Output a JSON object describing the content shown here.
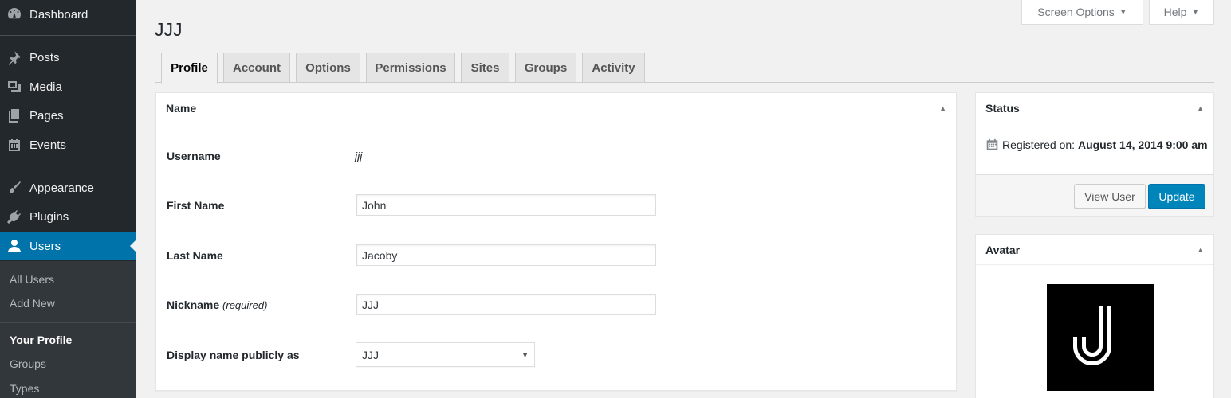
{
  "sidebar": {
    "items": [
      {
        "label": "Dashboard",
        "icon": "dashboard-icon"
      },
      {
        "label": "Posts",
        "icon": "pushpin-icon"
      },
      {
        "label": "Media",
        "icon": "media-icon"
      },
      {
        "label": "Pages",
        "icon": "pages-icon"
      },
      {
        "label": "Events",
        "icon": "calendar-icon"
      },
      {
        "label": "Appearance",
        "icon": "paintbrush-icon"
      },
      {
        "label": "Plugins",
        "icon": "plug-icon"
      },
      {
        "label": "Users",
        "icon": "user-icon"
      }
    ],
    "submenu": [
      "All Users",
      "Add New",
      "Your Profile",
      "Groups",
      "Types"
    ]
  },
  "screen_options": {
    "label": "Screen Options"
  },
  "help": {
    "label": "Help"
  },
  "page_title": "JJJ",
  "tabs": [
    "Profile",
    "Account",
    "Options",
    "Permissions",
    "Sites",
    "Groups",
    "Activity"
  ],
  "name_box": {
    "title": "Name",
    "username_label": "Username",
    "username_value": "jjj",
    "first_name_label": "First Name",
    "first_name_value": "John",
    "last_name_label": "Last Name",
    "last_name_value": "Jacoby",
    "nickname_label": "Nickname",
    "nickname_required": "(required)",
    "nickname_value": "JJJ",
    "display_name_label": "Display name publicly as",
    "display_name_value": "JJJ"
  },
  "status_box": {
    "title": "Status",
    "registered_label": "Registered on:",
    "registered_value": "August 14, 2014 9:00 am",
    "view_user_label": "View User",
    "update_label": "Update"
  },
  "avatar_box": {
    "title": "Avatar",
    "avatar_letter": "J"
  },
  "colors": {
    "sidebar": "#23282d",
    "accent": "#0073aa",
    "primary_button": "#0085ba"
  }
}
